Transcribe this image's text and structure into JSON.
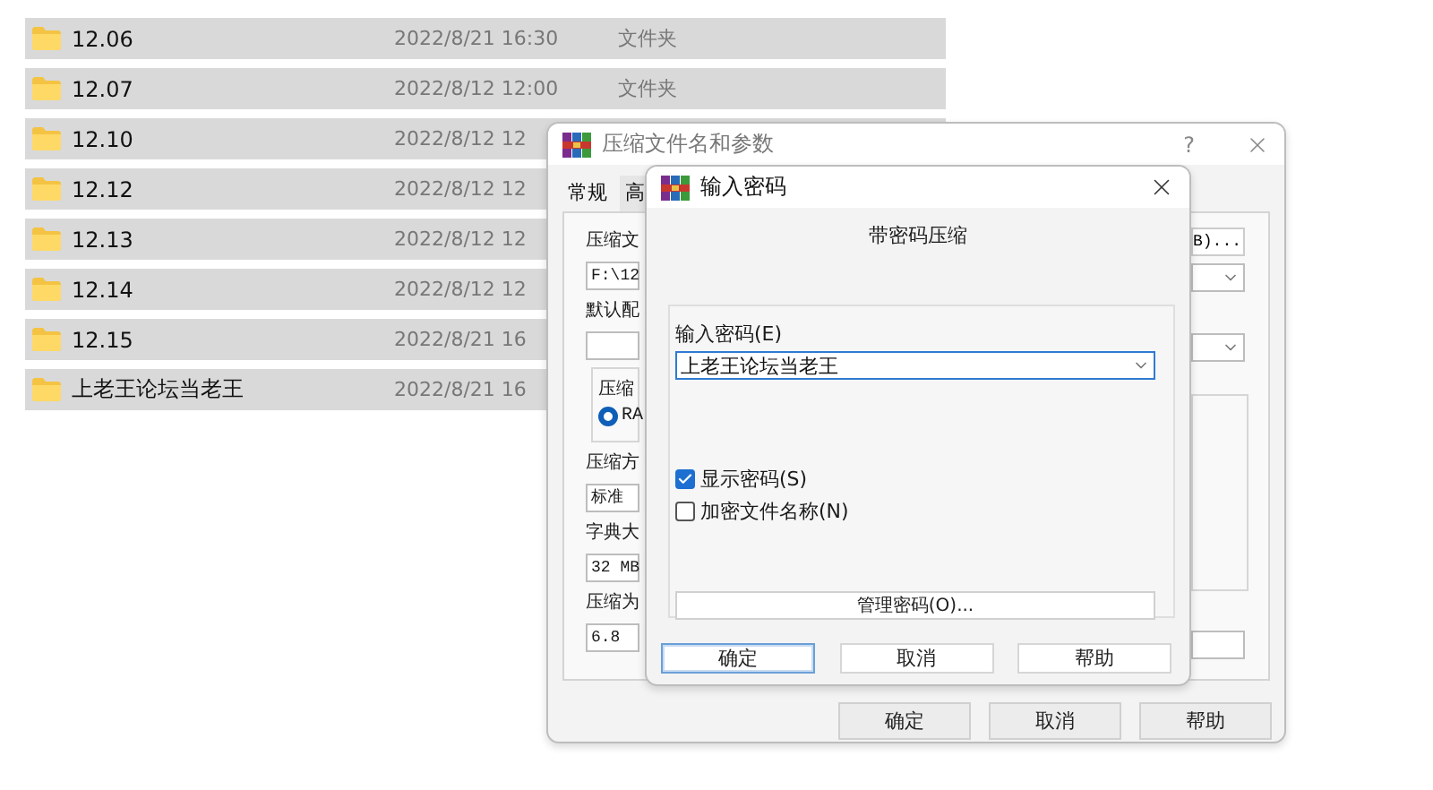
{
  "files": [
    {
      "name": "12.06",
      "modified": "2022/8/21 16:30",
      "type": "文件夹"
    },
    {
      "name": "12.07",
      "modified": "2022/8/12 12:00",
      "type": "文件夹"
    },
    {
      "name": "12.10",
      "modified": "2022/8/12 12"
    },
    {
      "name": "12.12",
      "modified": "2022/8/12 12"
    },
    {
      "name": "12.13",
      "modified": "2022/8/12 12"
    },
    {
      "name": "12.14",
      "modified": "2022/8/12 12"
    },
    {
      "name": "12.15",
      "modified": "2022/8/21 16"
    },
    {
      "name": "上老王论坛当老王",
      "modified": "2022/8/21 16"
    }
  ],
  "archive_dialog": {
    "title": "压缩文件名和参数",
    "help": "?",
    "tabs": [
      {
        "label": "常规",
        "selected": true
      },
      {
        "label": "高",
        "selected": false
      }
    ],
    "left_items": [
      {
        "kind": "label",
        "text": "压缩文"
      },
      {
        "kind": "field",
        "text": "F:\\12"
      },
      {
        "kind": "label",
        "text": "默认配"
      },
      {
        "kind": "field"
      },
      {
        "kind": "group",
        "text": "压缩",
        "radio": {
          "label": "RA",
          "selected": true
        }
      },
      {
        "kind": "label",
        "text": "压缩方"
      },
      {
        "kind": "field",
        "text": "标准"
      },
      {
        "kind": "label",
        "text": "字典大"
      },
      {
        "kind": "field",
        "text": "32 MB"
      },
      {
        "kind": "label",
        "text": "压缩为"
      },
      {
        "kind": "field",
        "text": "6.8"
      }
    ],
    "browse_button": "B)...",
    "buttons": [
      "确定",
      "取消",
      "帮助"
    ]
  },
  "password_dialog": {
    "title": "输入密码",
    "heading": "带密码压缩",
    "password_label": "输入密码(E)",
    "password": "上老王论坛当老王",
    "options": [
      {
        "label": "显示密码(S)",
        "checked": true
      },
      {
        "label": "加密文件名称(N)",
        "checked": false
      }
    ],
    "manage_button": "管理密码(O)...",
    "buttons": [
      {
        "label": "确定",
        "default": true
      },
      {
        "label": "取消",
        "default": false
      },
      {
        "label": "帮助",
        "default": false
      }
    ]
  }
}
